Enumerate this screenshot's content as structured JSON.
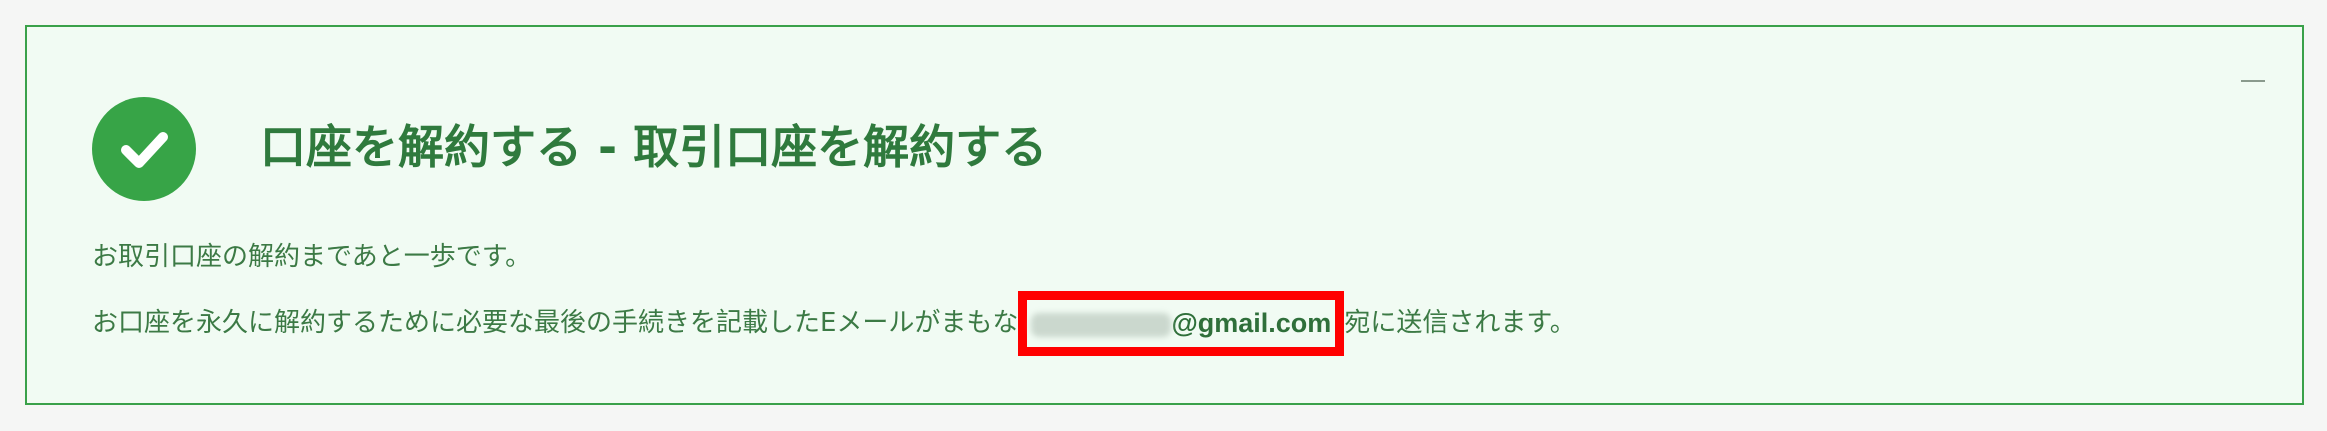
{
  "panel": {
    "title": "口座を解約する - 取引口座を解約する",
    "message_line1": "お取引口座の解約まであと一歩です。",
    "message_line2_before": "お口座を永久に解約するために必要な最後の手続きを記載したEメールがまもな",
    "email_domain": "@gmail.com",
    "message_line2_after": "宛に送信されます。",
    "status_icon": "check-icon",
    "collapse_icon": "minus-icon"
  },
  "colors": {
    "accent_green": "#37a447",
    "title_green": "#2f7a3d",
    "highlight_red": "#ff0000",
    "panel_background": "#f1fbf3"
  }
}
